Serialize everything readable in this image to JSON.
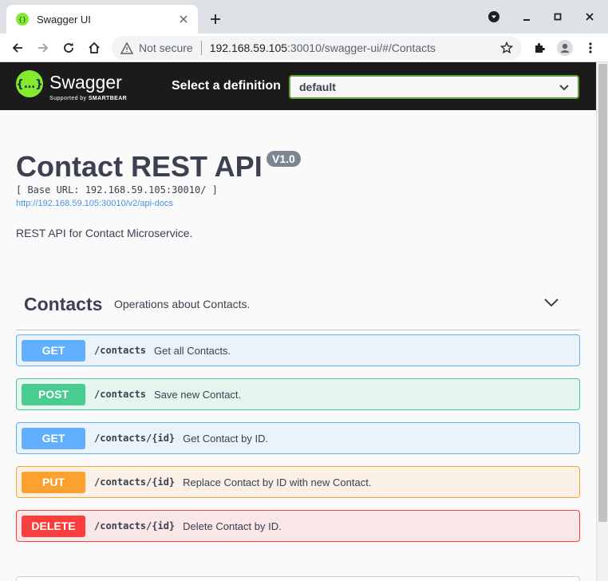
{
  "browser": {
    "tab_title": "Swagger UI",
    "security_label": "Not secure",
    "url_host": "192.168.59.105",
    "url_rest": ":30010/swagger-ui/#/Contacts",
    "icons": [
      "swagger-favicon",
      "close-icon",
      "plus-icon",
      "media-icon",
      "minimize-icon",
      "maximize-icon",
      "close-window-icon",
      "back-icon",
      "forward-icon",
      "reload-icon",
      "home-icon",
      "warning-icon",
      "star-icon",
      "puzzle-icon",
      "profile-icon",
      "kebab-menu-icon"
    ]
  },
  "swagger": {
    "brand": "Swagger",
    "supported_by": "Supported by",
    "smartbear": "SMARTBEAR",
    "select_label": "Select a definition",
    "selected_definition": "default",
    "accent": "#85ea2d"
  },
  "info": {
    "title": "Contact REST API",
    "version": "V1.0",
    "base_url": "[ Base URL: 192.168.59.105:30010/ ]",
    "api_docs_link": "http://192.168.59.105:30010/v2/api-docs",
    "description": "REST API for Contact Microservice."
  },
  "tag": {
    "name": "Contacts",
    "description": "Operations about Contacts."
  },
  "operations": [
    {
      "method": "GET",
      "path": "/contacts",
      "summary": "Get all Contacts.",
      "color": "#61affe"
    },
    {
      "method": "POST",
      "path": "/contacts",
      "summary": "Save new Contact.",
      "color": "#49cc90"
    },
    {
      "method": "GET",
      "path": "/contacts/{id}",
      "summary": "Get Contact by ID.",
      "color": "#61affe"
    },
    {
      "method": "PUT",
      "path": "/contacts/{id}",
      "summary": "Replace Contact by ID with new Contact.",
      "color": "#fca130"
    },
    {
      "method": "DELETE",
      "path": "/contacts/{id}",
      "summary": "Delete Contact by ID.",
      "color": "#f93e3e"
    }
  ]
}
